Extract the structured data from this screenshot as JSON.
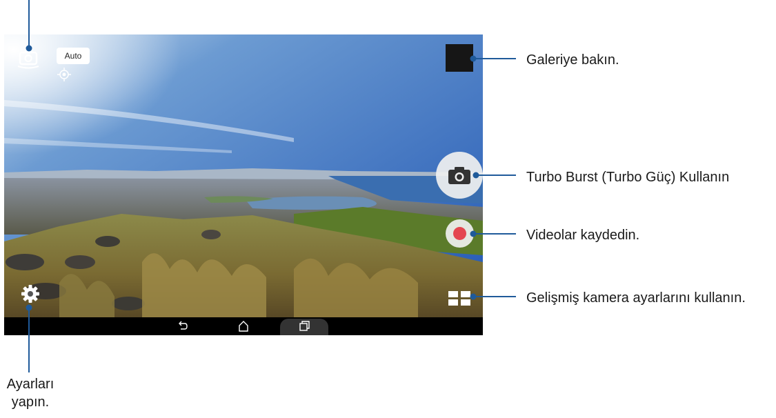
{
  "camera": {
    "scene_mode_label": "Auto",
    "icons": {
      "switch_camera": "switch-camera-icon",
      "focus": "focus-crosshair-icon",
      "shutter": "camera-icon",
      "record": "record-icon",
      "modes": "camera-modes-icon",
      "settings": "gear-icon"
    },
    "accent_record": "#e4464f"
  },
  "navbar": {
    "back": "back-icon",
    "home": "home-icon",
    "recents": "recents-icon"
  },
  "callouts": {
    "gallery": "Galeriye bakın.",
    "turbo_burst": "Turbo Burst (Turbo Güç) Kullanın",
    "video": "Videolar kaydedin.",
    "advanced": "Gelişmiş kamera ayarlarını kullanın.",
    "settings_line1": "Ayarları",
    "settings_line2": "yapın."
  }
}
